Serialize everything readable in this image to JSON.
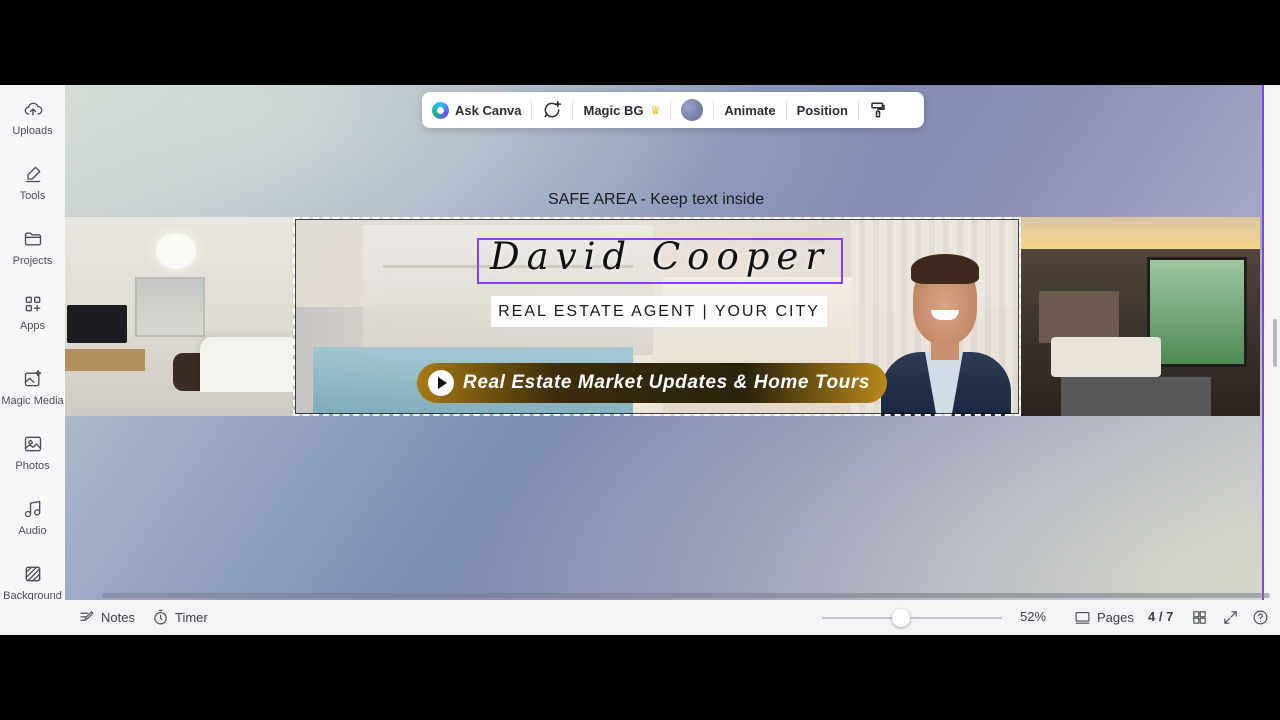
{
  "sidebar": {
    "items": [
      {
        "label": "Uploads",
        "icon": "cloud-upload-icon"
      },
      {
        "label": "Tools",
        "icon": "pen-tool-icon"
      },
      {
        "label": "Projects",
        "icon": "folder-icon"
      },
      {
        "label": "Apps",
        "icon": "apps-grid-icon"
      },
      {
        "label": "Magic Media",
        "icon": "magic-media-icon"
      },
      {
        "label": "Photos",
        "icon": "photo-icon"
      },
      {
        "label": "Audio",
        "icon": "music-note-icon"
      },
      {
        "label": "Background",
        "icon": "background-pattern-icon"
      }
    ]
  },
  "toolbar": {
    "ask_canva": "Ask Canva",
    "magic_bg": "Magic BG",
    "animate": "Animate",
    "position": "Position"
  },
  "canvas": {
    "safe_area_label": "SAFE AREA - Keep text inside",
    "banner": {
      "name": "David Cooper",
      "subtitle": "REAL ESTATE AGENT | YOUR CITY",
      "tagline": "Real Estate Market Updates & Home Tours"
    }
  },
  "bottom_bar": {
    "notes": "Notes",
    "timer": "Timer",
    "zoom_percent": "52%",
    "zoom_level": 0.44,
    "pages_label": "Pages",
    "page_indicator": "4 / 7"
  },
  "colors": {
    "accent": "#8b3dff",
    "crown": "#f3b814"
  }
}
